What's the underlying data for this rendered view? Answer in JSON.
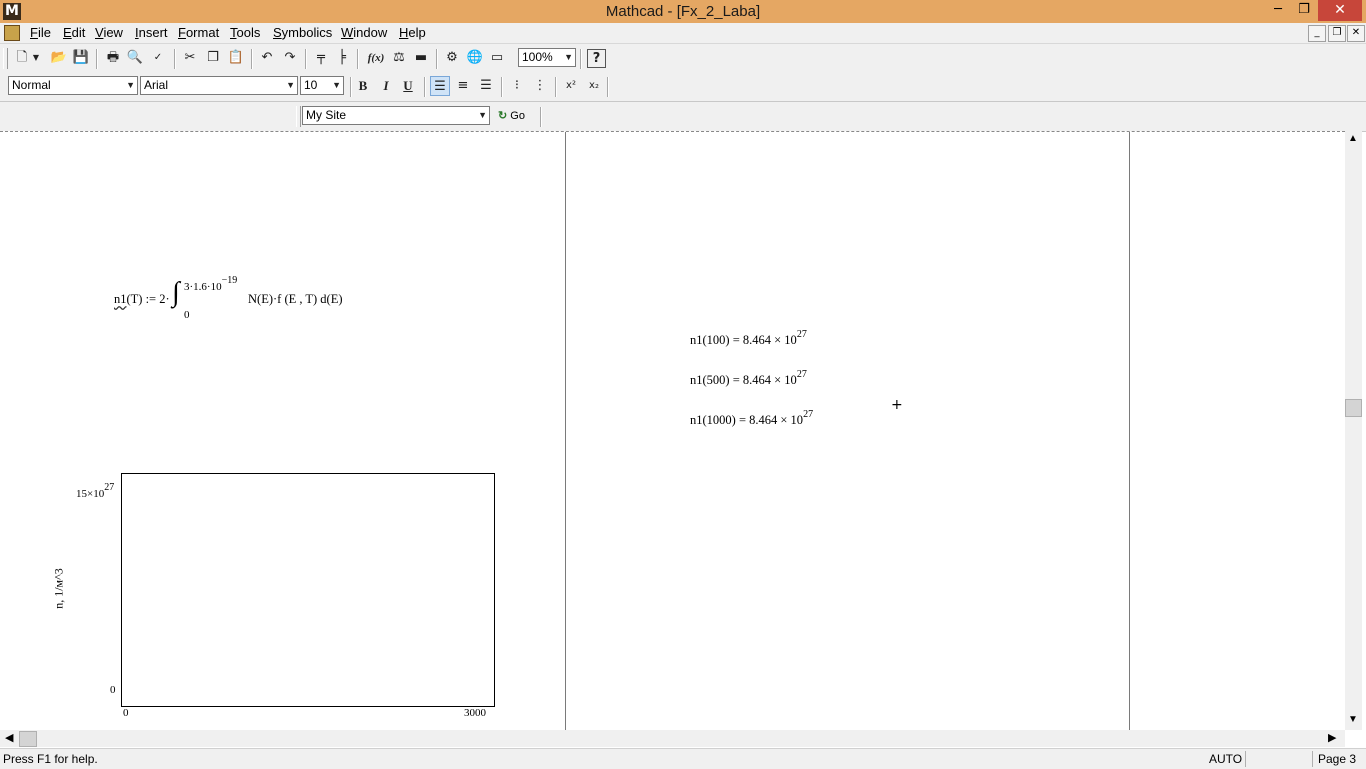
{
  "window": {
    "app_icon_letter": "M",
    "title": "Mathcad - [Fx_2_Laba]",
    "controls": {
      "minimize": "─",
      "restore": "❐",
      "close": "✕"
    }
  },
  "menu": {
    "items": [
      {
        "label": "File",
        "accel": "F",
        "rest": "ile"
      },
      {
        "label": "Edit",
        "accel": "E",
        "rest": "dit"
      },
      {
        "label": "View",
        "accel": "V",
        "rest": "iew"
      },
      {
        "label": "Insert",
        "accel": "I",
        "rest": "nsert"
      },
      {
        "label": "Format",
        "accel": "F",
        "rest": "ormat"
      },
      {
        "label": "Tools",
        "accel": "T",
        "rest": "ools"
      },
      {
        "label": "Symbolics",
        "accel": "S",
        "rest": "ymbolics"
      },
      {
        "label": "Window",
        "accel": "W",
        "rest": "indow"
      },
      {
        "label": "Help",
        "accel": "H",
        "rest": "elp"
      }
    ],
    "mdi": {
      "minimize": "_",
      "restore": "❐",
      "close": "✕"
    }
  },
  "toolbar": {
    "zoom": "100%",
    "style": "Normal",
    "font": "Arial",
    "font_size": "10",
    "bold": "B",
    "italic": "I",
    "underline": "U",
    "fx_label": "f(x)",
    "superscript": "x²",
    "subscript": "x₂",
    "help": "?",
    "site": "My Site",
    "go": "Go"
  },
  "worksheet": {
    "definition": {
      "lhs": "n1",
      "lhs_rest": "(T) := 2·",
      "upper_limit": "3·1.6·10",
      "upper_exp": "−19",
      "lower_limit": "0",
      "integrand": "N(E)·f (E , T) d(E)"
    },
    "results": [
      {
        "expr": "n1(100) = 8.464 × 10",
        "exp": "27"
      },
      {
        "expr": "n1(500) = 8.464 × 10",
        "exp": "27"
      },
      {
        "expr": "n1(1000) = 8.464 × 10",
        "exp": "27"
      }
    ],
    "plot": {
      "ylabel": "n, 1/м^3",
      "y_max_mantissa": "15×10",
      "y_max_exp": "27",
      "y_min": "0",
      "x_min": "0",
      "x_max": "3000"
    }
  },
  "chart_data": {
    "type": "line",
    "ylabel": "n, 1/м^3",
    "xlabel": "",
    "xlim": [
      0,
      3000
    ],
    "ylim": [
      0,
      1.5e+28
    ],
    "series": []
  },
  "status": {
    "help": "Press F1 for help.",
    "mode": "AUTO",
    "page": "Page 3"
  }
}
